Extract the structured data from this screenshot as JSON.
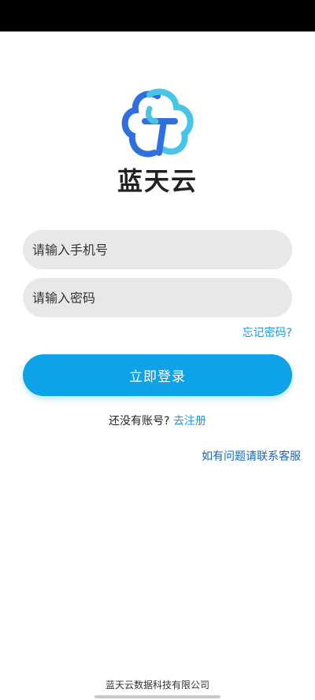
{
  "brand": {
    "name": "蓝天云",
    "logo_icon": "cloud-logo-icon",
    "colors": {
      "blue": "#2f6fe0",
      "cyan": "#48c5e6",
      "text": "#222222"
    }
  },
  "login_form": {
    "phone_placeholder": "请输入手机号",
    "phone_value": "",
    "password_placeholder": "请输入密码",
    "password_value": "",
    "forgot_password": "忘记密码?",
    "submit_label": "立即登录"
  },
  "register": {
    "prompt": "还没有账号?",
    "link": "去注册"
  },
  "contact_link": "如有问题请联系客服",
  "footer": {
    "company": "蓝天云数据科技有限公司"
  },
  "theme": {
    "accent": "#0ea2e8",
    "link": "#1a99e0",
    "input_bg": "#e8e8e8"
  }
}
